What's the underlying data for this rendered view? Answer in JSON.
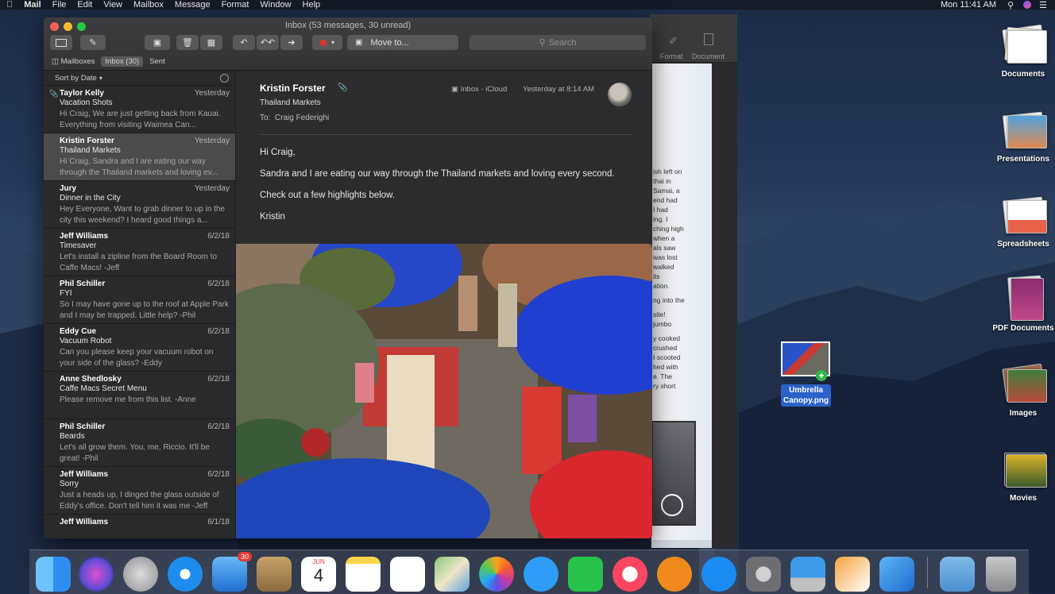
{
  "menubar": {
    "app": "Mail",
    "items": [
      "File",
      "Edit",
      "View",
      "Mailbox",
      "Message",
      "Format",
      "Window",
      "Help"
    ],
    "clock": "Mon 11:41 AM"
  },
  "window": {
    "title": "Inbox (53 messages, 30 unread)",
    "toolbar": {
      "move_to": "Move to...",
      "search_placeholder": "Search"
    },
    "tabs": {
      "mailboxes": "Mailboxes",
      "inbox": "Inbox (30)",
      "sent": "Sent"
    },
    "sort_label": "Sort by Date"
  },
  "messages": [
    {
      "from": "Taylor Kelly",
      "date": "Yesterday",
      "subject": "Vacation Shots",
      "preview": "Hi Craig, We are just getting back from Kauai. Everything from visiting Waimea Can...",
      "attachment": true
    },
    {
      "from": "Kristin Forster",
      "date": "Yesterday",
      "subject": "Thailand Markets",
      "preview": "Hi Craig, Sandra and I are eating our way through the Thailand markets and loving ev...",
      "selected": true
    },
    {
      "from": "Jury",
      "date": "Yesterday",
      "subject": "Dinner in the City",
      "preview": "Hey Everyone, Want to grab dinner to up in the city this weekend? I heard good things a..."
    },
    {
      "from": "Jeff Williams",
      "date": "6/2/18",
      "subject": "Timesaver",
      "preview": "Let's install a zipline from the Board Room to Caffe Macs! -Jeff"
    },
    {
      "from": "Phil Schiller",
      "date": "6/2/18",
      "subject": "FYI",
      "preview": "So I may have gone up to the roof at Apple Park and I may be trapped. Little help? -Phil"
    },
    {
      "from": "Eddy Cue",
      "date": "6/2/18",
      "subject": "Vacuum Robot",
      "preview": "Can you please keep your vacuum robot on your side of the glass? -Eddy"
    },
    {
      "from": "Anne Shedlosky",
      "date": "6/2/18",
      "subject": "Caffe Macs Secret Menu",
      "preview": "Please remove me from this list. -Anne"
    },
    {
      "from": "Phil Schiller",
      "date": "6/2/18",
      "subject": "Beards",
      "preview": "Let's all grow them. You, me, Riccio. It'll be great! -Phil"
    },
    {
      "from": "Jeff Williams",
      "date": "6/2/18",
      "subject": "Sorry",
      "preview": "Just a heads up, I dinged the glass outside of Eddy's office. Don't tell him it was me -Jeff"
    },
    {
      "from": "Jeff Williams",
      "date": "6/1/18",
      "subject": "",
      "preview": ""
    }
  ],
  "reader": {
    "from": "Kristin Forster",
    "subject": "Thailand Markets",
    "to_label": "To:",
    "to": "Craig Federighi",
    "mailbox": "Inbox - iCloud",
    "date": "Yesterday at 8:14 AM",
    "body": [
      "Hi Craig,",
      "Sandra and I are eating our way through the Thailand markets and loving every second.",
      "Check out a few highlights below.",
      "Kristin"
    ]
  },
  "pages_window": {
    "toolbar": {
      "format": "Format",
      "document": "Document"
    },
    "text_lines": [
      "ish left on",
      "thai in",
      "Samai, a",
      "end had",
      "I had",
      "ing. I",
      "ching high",
      "when a",
      "als saw",
      "was lost",
      "walked",
      "its",
      "ation.",
      "",
      "ng into the",
      "",
      "site!",
      "jumbo",
      "",
      "y cooked",
      "crushed",
      "I scooted",
      "hed with",
      "e. The",
      "ry short"
    ]
  },
  "desktop": {
    "stacks": [
      "Documents",
      "Presentations",
      "Spreadsheets",
      "PDF Documents",
      "Images",
      "Movies"
    ],
    "dragged_file": "Umbrella Canopy.png"
  },
  "dock": {
    "calendar_month": "JUN",
    "calendar_day": "4",
    "mail_badge": "30",
    "colors": {
      "finder": "#2e8ff0",
      "siri": "#5b4dd6",
      "safari": "#1d8df0",
      "photos": "#ffffff",
      "messages": "#2f9cf7",
      "facetime": "#27c24a",
      "music": "#fb4661",
      "books": "#f08a1c",
      "appstore": "#1a8cf4",
      "prefs": "#8e8e93"
    }
  }
}
